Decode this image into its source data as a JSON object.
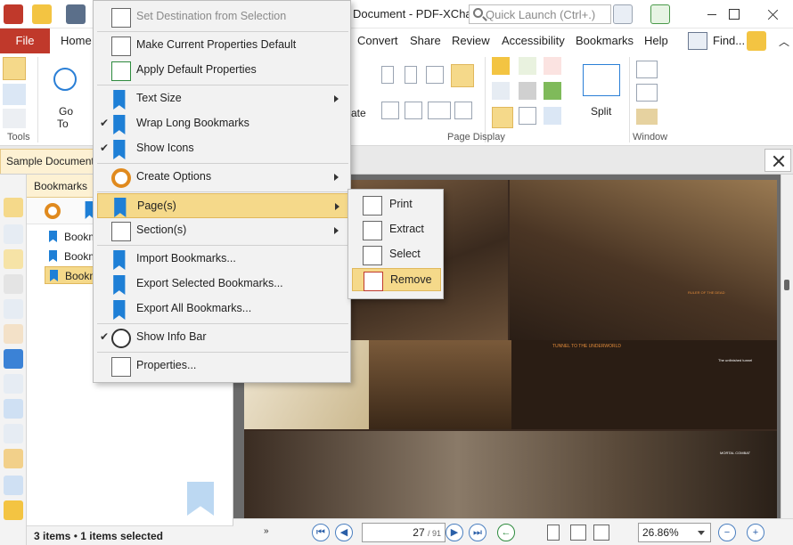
{
  "window": {
    "title": "Document - PDF-XCha...",
    "quick_launch_placeholder": "Quick Launch (Ctrl+.)"
  },
  "ribbon": {
    "file_tab": "File",
    "tabs": [
      "Home",
      "Convert",
      "Share",
      "Review",
      "Accessibility",
      "Bookmarks",
      "Help"
    ],
    "find_label": "Find...",
    "tools_label": "Tools",
    "goto_label_line1": "Go",
    "goto_label_line2": "To",
    "rotate_label_fragment": "ate",
    "page_display_label": "Page Display",
    "split_label": "Split",
    "window_label": "Window"
  },
  "doc_tab": {
    "label": "Sample Document"
  },
  "bookmarks_pane": {
    "title": "Bookmarks",
    "items": [
      "Bookm",
      "Bookm",
      "Bookm"
    ],
    "status_count": "3 items",
    "status_selected": "1 items selected"
  },
  "menu": {
    "items": [
      {
        "label": "Set Destination from Selection",
        "disabled": true
      },
      {
        "label": "Make Current Properties Default"
      },
      {
        "label": "Apply Default Properties"
      },
      {
        "label": "Text Size",
        "submenu": true
      },
      {
        "label": "Wrap Long Bookmarks",
        "checked": true
      },
      {
        "label": "Show Icons",
        "checked": true
      },
      {
        "label": "Create Options",
        "submenu": true
      },
      {
        "label": "Page(s)",
        "submenu": true,
        "highlighted": true
      },
      {
        "label": "Section(s)",
        "submenu": true
      },
      {
        "label": "Import Bookmarks..."
      },
      {
        "label": "Export Selected Bookmarks..."
      },
      {
        "label": "Export All Bookmarks..."
      },
      {
        "label": "Show Info Bar",
        "checked": true
      },
      {
        "label": "Properties..."
      }
    ],
    "check_glyph": "✔"
  },
  "submenu": {
    "items": [
      {
        "label": "Print"
      },
      {
        "label": "Extract"
      },
      {
        "label": "Select"
      },
      {
        "label": "Remove",
        "highlighted": true
      }
    ]
  },
  "page_content": {
    "heading_tunnel": "TUNNEL TO THE UNDERWORLD",
    "heading_ruler": "RULER OF THE DEAD",
    "heading_mortal": "MORTAL COMBAT",
    "heading_tunnel_right": "The unfinished tunnel"
  },
  "navigation": {
    "current_page": "27",
    "total_pages": "/ 91",
    "zoom": "26.86%"
  },
  "colors": {
    "accent": "#c0392b",
    "highlight": "#f5d98a",
    "tab_bg": "#fdf1d3"
  }
}
